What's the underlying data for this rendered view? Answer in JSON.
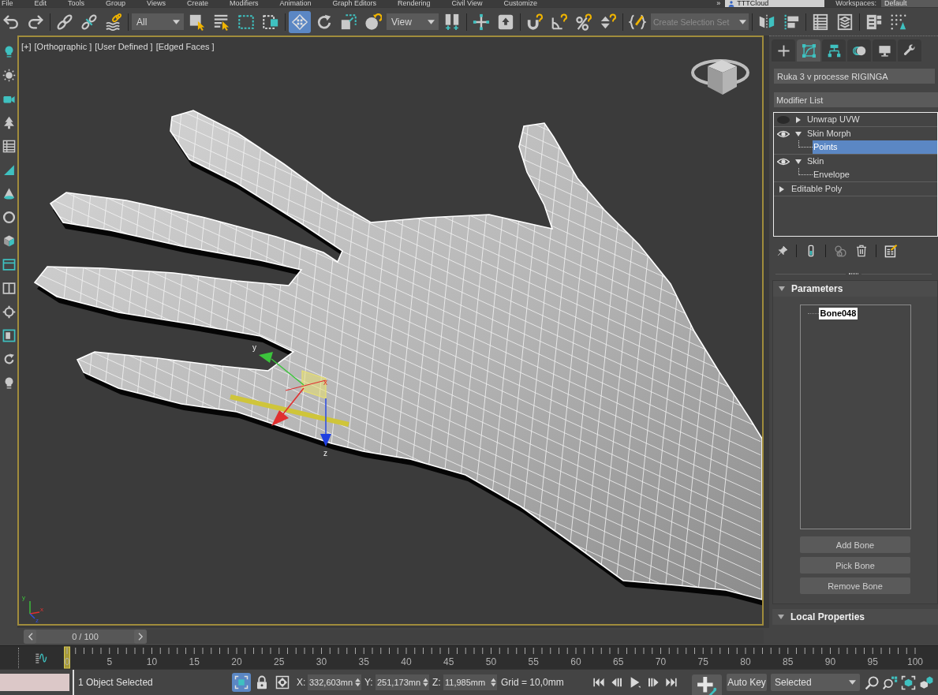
{
  "menu": [
    "File",
    "Edit",
    "Tools",
    "Group",
    "Views",
    "Create",
    "Modifiers",
    "Animation",
    "Graph Editors",
    "Rendering",
    "Civil View",
    "Customize"
  ],
  "account": {
    "overflow": "»",
    "user": "TTTCloud"
  },
  "workspace": {
    "label": "Workspaces:",
    "value": "Default"
  },
  "toolbar": {
    "groups": [
      [
        {
          "kind": "button",
          "selected": false
        },
        {
          "kind": "button",
          "selected": false
        }
      ],
      [
        {
          "kind": "button",
          "selected": false
        },
        {
          "kind": "button",
          "selected": false
        },
        {
          "kind": "button",
          "selected": false
        }
      ],
      [
        {
          "kind": "dropdown",
          "value": "All"
        },
        {
          "kind": "button",
          "selected": false
        },
        {
          "kind": "button",
          "selected": false
        },
        {
          "kind": "button",
          "selected": false
        },
        {
          "kind": "button",
          "selected": false
        }
      ],
      [
        {
          "kind": "button",
          "selected": true
        },
        {
          "kind": "button",
          "selected": false
        },
        {
          "kind": "button",
          "selected": false
        },
        {
          "kind": "button",
          "selected": false
        },
        {
          "kind": "dropdown",
          "value": "View"
        },
        {
          "kind": "button",
          "selected": false
        }
      ],
      [
        {
          "kind": "button",
          "selected": false
        },
        {
          "kind": "button",
          "selected": false
        }
      ],
      [
        {
          "kind": "button",
          "selected": false
        },
        {
          "kind": "button",
          "selected": false
        },
        {
          "kind": "button",
          "selected": false
        },
        {
          "kind": "button",
          "selected": false
        }
      ],
      [
        {
          "kind": "button",
          "selected": false
        },
        {
          "kind": "combo",
          "placeholder": "Create Selection Set"
        }
      ],
      [
        {
          "kind": "button",
          "selected": false
        },
        {
          "kind": "button",
          "selected": false
        }
      ],
      [
        {
          "kind": "button",
          "selected": false
        },
        {
          "kind": "button",
          "selected": false
        }
      ],
      [
        {
          "kind": "button",
          "selected": false
        },
        {
          "kind": "button",
          "selected": false
        }
      ]
    ]
  },
  "viewport": {
    "labels": [
      "[+]",
      "[Orthographic ]",
      "[User Defined ]",
      "[Edged Faces ]"
    ],
    "gizmo_axes": [
      "y",
      "x",
      "z"
    ],
    "tripod_axes": [
      "y",
      "x",
      "z"
    ]
  },
  "command_panel": {
    "tabs": [
      {
        "selected": false
      },
      {
        "selected": true
      },
      {
        "selected": false
      },
      {
        "selected": false
      },
      {
        "selected": false
      },
      {
        "selected": false
      }
    ],
    "object_name": "Ruka 3 v processe RIGINGA",
    "modifier_list": "Modifier List",
    "stack": [
      {
        "kind": "modifier",
        "label": "Unwrap UVW",
        "visible": false,
        "expanded": false,
        "selected": false
      },
      {
        "kind": "modifier",
        "label": "Skin Morph",
        "visible": true,
        "expanded": true,
        "selected": false,
        "children": [
          {
            "label": "Points",
            "selected": true
          }
        ]
      },
      {
        "kind": "modifier",
        "label": "Skin",
        "visible": true,
        "expanded": true,
        "selected": false,
        "children": [
          {
            "label": "Envelope",
            "selected": false
          }
        ]
      },
      {
        "kind": "base",
        "label": "Editable Poly",
        "expanded": false,
        "selected": false
      }
    ],
    "rollouts": [
      {
        "title": "Parameters",
        "expanded": true,
        "bones": [
          {
            "label": "Bone048",
            "selected": true
          }
        ],
        "buttons": [
          "Add Bone",
          "Pick Bone",
          "Remove Bone"
        ]
      },
      {
        "title": "Local Properties",
        "expanded": true
      }
    ]
  },
  "time_slider": {
    "label": "0 / 100",
    "level": 0
  },
  "trackbar": {
    "frames": [
      "0",
      "5",
      "10",
      "15",
      "20",
      "25",
      "30",
      "35",
      "40",
      "45",
      "50",
      "55",
      "60",
      "65",
      "70",
      "75",
      "80",
      "85",
      "90",
      "95",
      "100"
    ]
  },
  "status_bar": {
    "message": "1 Object Selected",
    "toggles": [
      {
        "on": true
      },
      {
        "on": false
      },
      {
        "on": false
      }
    ],
    "coordinates": [
      {
        "axis": "X:",
        "value": "332,603mn"
      },
      {
        "axis": "Y:",
        "value": "251,173mn"
      },
      {
        "axis": "Z:",
        "value": "11,985mm"
      }
    ],
    "grid": "Grid = 10,0mm",
    "auto_key": {
      "label": "Auto Key",
      "on": false
    },
    "key_filter": "Selected"
  }
}
